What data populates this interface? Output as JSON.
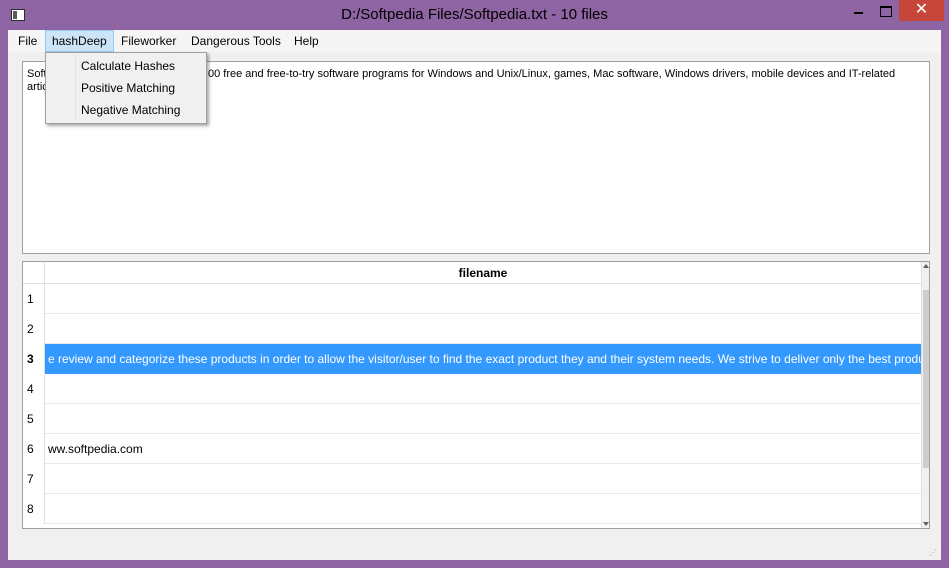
{
  "window": {
    "title": "D:/Softpedia Files/Softpedia.txt - 10 files",
    "close_glyph": "✕"
  },
  "menubar": {
    "items": [
      "File",
      "hashDeep",
      "Fileworker",
      "Dangerous Tools",
      "Help"
    ]
  },
  "hashdeep_menu": {
    "items": [
      "Calculate Hashes",
      "Positive Matching",
      "Negative Matching"
    ]
  },
  "text_area": {
    "line1_left": "Soft",
    "line1_right": "00 free and free-to-try software programs for Windows and Unix/Linux, games, Mac software, Windows drivers, mobile devices and IT-related",
    "line2_left": "artic"
  },
  "table": {
    "column_header": "filename",
    "rows": [
      {
        "num": "1",
        "value": ""
      },
      {
        "num": "2",
        "value": ""
      },
      {
        "num": "3",
        "value": "e review and categorize these products in order to allow the visitor/user to find the exact product they and their system needs. We strive to deliver only the best produc"
      },
      {
        "num": "4",
        "value": ""
      },
      {
        "num": "5",
        "value": ""
      },
      {
        "num": "6",
        "value": "ww.softpedia.com"
      },
      {
        "num": "7",
        "value": ""
      },
      {
        "num": "8",
        "value": ""
      }
    ],
    "selected_row": 3
  },
  "colors": {
    "title_bar": "#8e64a3",
    "close_button": "#c7463b",
    "selection": "#3399ff",
    "menu_highlight": "#cce4f7"
  },
  "icons": {
    "app": "app-window-icon",
    "resize": "size-grip-icon"
  }
}
